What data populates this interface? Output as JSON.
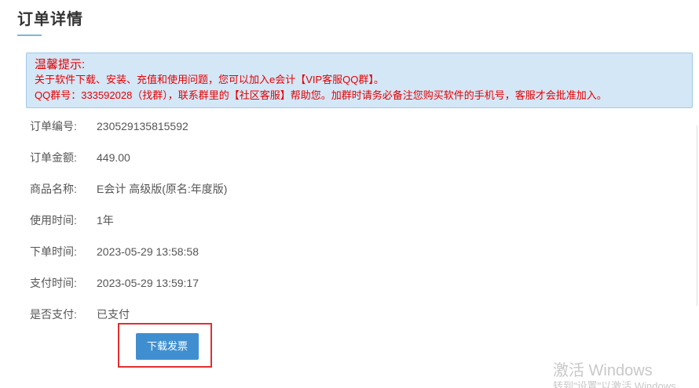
{
  "page": {
    "title": "订单详情"
  },
  "notice": {
    "title": "温馨提示:",
    "line1": "关于软件下载、安装、充值和使用问题，您可以加入e会计【VIP客服QQ群】。",
    "line2": "QQ群号：333592028（找群），联系群里的【社区客服】帮助您。加群时请务必备注您购买软件的手机号，客服才会批准加入。"
  },
  "details": [
    {
      "label": "订单编号:",
      "value": "230529135815592"
    },
    {
      "label": "订单金额:",
      "value": "449.00"
    },
    {
      "label": "商品名称:",
      "value": "E会计 高级版(原名:年度版)"
    },
    {
      "label": "使用时间:",
      "value": "1年"
    },
    {
      "label": "下单时间:",
      "value": "2023-05-29 13:58:58"
    },
    {
      "label": "支付时间:",
      "value": "2023-05-29 13:59:17"
    },
    {
      "label": "是否支付:",
      "value": "已支付"
    }
  ],
  "actions": {
    "download_invoice_label": "下载发票"
  },
  "watermark": {
    "title": "激活 Windows",
    "subtitle": "转到\"设置\"以激活 Windows"
  },
  "colors": {
    "notice_text": "#e50000",
    "notice_bg": "#d4e7f7",
    "button_bg": "#3f8fd0",
    "highlight_border": "#e03030",
    "title_underline": "#7ab8dc"
  }
}
